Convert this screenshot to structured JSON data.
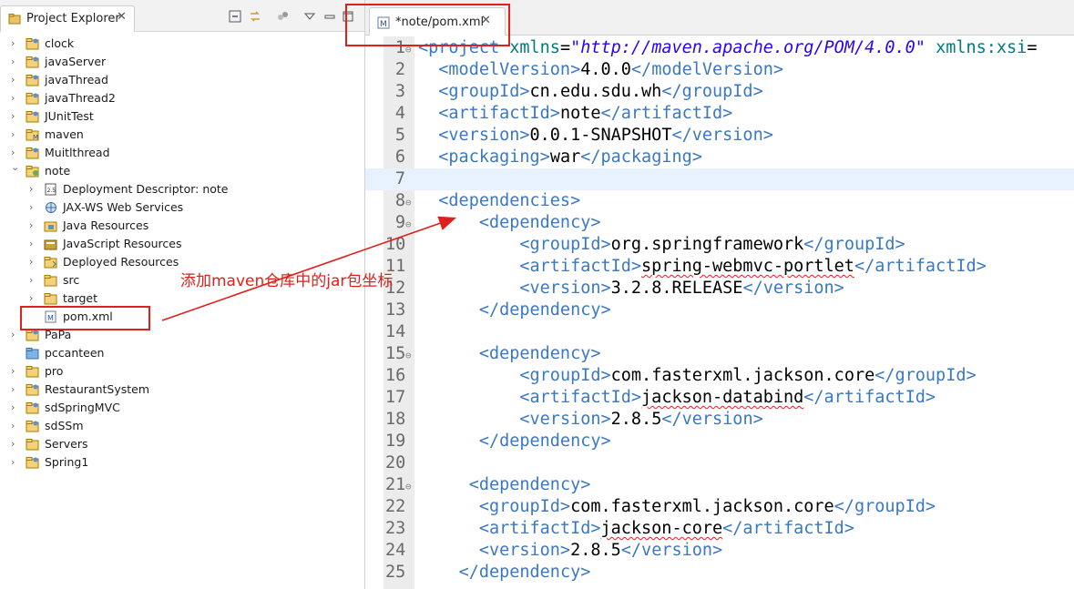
{
  "explorer": {
    "title": "Project Explorer",
    "close_glyph": "✕",
    "toolbar": [
      "collapse-all-icon",
      "link-with-editor-icon",
      "filters-icon",
      "view-menu-icon",
      "minimize-icon",
      "maximize-icon"
    ],
    "items": [
      {
        "label": "clock",
        "depth": 0,
        "expanded": false,
        "icon": "java-project-icon"
      },
      {
        "label": "javaServer",
        "depth": 0,
        "expanded": false,
        "icon": "java-project-icon"
      },
      {
        "label": "javaThread",
        "depth": 0,
        "expanded": false,
        "icon": "java-project-icon"
      },
      {
        "label": "javaThread2",
        "depth": 0,
        "expanded": false,
        "icon": "java-project-icon"
      },
      {
        "label": "JUnitTest",
        "depth": 0,
        "expanded": false,
        "icon": "java-project-icon"
      },
      {
        "label": "maven",
        "depth": 0,
        "expanded": false,
        "icon": "maven-project-icon"
      },
      {
        "label": "Muitlthread",
        "depth": 0,
        "expanded": false,
        "icon": "java-project-icon"
      },
      {
        "label": "note",
        "depth": 0,
        "expanded": true,
        "icon": "web-project-icon"
      },
      {
        "label": "Deployment Descriptor: note",
        "depth": 1,
        "expanded": false,
        "icon": "deployment-descriptor-icon"
      },
      {
        "label": "JAX-WS Web Services",
        "depth": 1,
        "expanded": false,
        "icon": "web-services-icon"
      },
      {
        "label": "Java Resources",
        "depth": 1,
        "expanded": false,
        "icon": "java-resources-icon"
      },
      {
        "label": "JavaScript Resources",
        "depth": 1,
        "expanded": false,
        "icon": "javascript-resources-icon"
      },
      {
        "label": "Deployed Resources",
        "depth": 1,
        "expanded": false,
        "icon": "deployed-resources-icon"
      },
      {
        "label": "src",
        "depth": 1,
        "expanded": false,
        "icon": "folder-icon"
      },
      {
        "label": "target",
        "depth": 1,
        "expanded": false,
        "icon": "folder-icon"
      },
      {
        "label": "pom.xml",
        "depth": 1,
        "leaf": true,
        "icon": "maven-pom-file-icon"
      },
      {
        "label": "PaPa",
        "depth": 0,
        "expanded": false,
        "icon": "java-project-icon"
      },
      {
        "label": "pccanteen",
        "depth": 0,
        "leaf": true,
        "icon": "plain-folder-icon"
      },
      {
        "label": "pro",
        "depth": 0,
        "expanded": false,
        "icon": "folder-icon"
      },
      {
        "label": "RestaurantSystem",
        "depth": 0,
        "expanded": false,
        "icon": "java-project-icon"
      },
      {
        "label": "sdSpringMVC",
        "depth": 0,
        "expanded": false,
        "icon": "java-project-icon"
      },
      {
        "label": "sdSSm",
        "depth": 0,
        "expanded": false,
        "icon": "java-project-icon"
      },
      {
        "label": "Servers",
        "depth": 0,
        "expanded": false,
        "icon": "folder-icon"
      },
      {
        "label": "Spring1",
        "depth": 0,
        "expanded": false,
        "icon": "java-project-icon"
      }
    ]
  },
  "editor": {
    "tab_title": "*note/pom.xml",
    "close_glyph": "✕",
    "current_line": 7,
    "lines": [
      {
        "n": "1",
        "fold": true,
        "tokens": [
          [
            "t",
            "<project "
          ],
          [
            "a",
            "xmlns"
          ],
          [
            "p",
            "="
          ],
          [
            "v",
            "\"http://maven.apache.org/POM/4.0.0\""
          ],
          [
            "p",
            " "
          ],
          [
            "a",
            "xmlns:xsi"
          ],
          [
            "p",
            "="
          ]
        ]
      },
      {
        "n": "2",
        "tokens": [
          [
            "p",
            "  "
          ],
          [
            "t",
            "<modelVersion>"
          ],
          [
            "p",
            "4.0.0"
          ],
          [
            "t",
            "</modelVersion>"
          ]
        ]
      },
      {
        "n": "3",
        "tokens": [
          [
            "p",
            "  "
          ],
          [
            "t",
            "<groupId>"
          ],
          [
            "p",
            "cn.edu.sdu.wh"
          ],
          [
            "t",
            "</groupId>"
          ]
        ]
      },
      {
        "n": "4",
        "tokens": [
          [
            "p",
            "  "
          ],
          [
            "t",
            "<artifactId>"
          ],
          [
            "p",
            "note"
          ],
          [
            "t",
            "</artifactId>"
          ]
        ]
      },
      {
        "n": "5",
        "tokens": [
          [
            "p",
            "  "
          ],
          [
            "t",
            "<version>"
          ],
          [
            "p",
            "0.0.1-SNAPSHOT"
          ],
          [
            "t",
            "</version>"
          ]
        ]
      },
      {
        "n": "6",
        "tokens": [
          [
            "p",
            "  "
          ],
          [
            "t",
            "<packaging>"
          ],
          [
            "p",
            "war"
          ],
          [
            "t",
            "</packaging>"
          ]
        ]
      },
      {
        "n": "7",
        "tokens": []
      },
      {
        "n": "8",
        "fold": true,
        "tokens": [
          [
            "p",
            "  "
          ],
          [
            "t",
            "<dependencies>"
          ]
        ]
      },
      {
        "n": "9",
        "fold": true,
        "tokens": [
          [
            "p",
            "      "
          ],
          [
            "t",
            "<dependency>"
          ]
        ]
      },
      {
        "n": "10",
        "tokens": [
          [
            "p",
            "          "
          ],
          [
            "t",
            "<groupId>"
          ],
          [
            "p",
            "org.springframework"
          ],
          [
            "t",
            "</groupId>"
          ]
        ]
      },
      {
        "n": "11",
        "tokens": [
          [
            "p",
            "          "
          ],
          [
            "t",
            "<artifactId>"
          ],
          [
            "s",
            "spring-webmvc-portlet"
          ],
          [
            "t",
            "</artifactId>"
          ]
        ]
      },
      {
        "n": "12",
        "tokens": [
          [
            "p",
            "          "
          ],
          [
            "t",
            "<version>"
          ],
          [
            "p",
            "3.2.8.RELEASE"
          ],
          [
            "t",
            "</version>"
          ]
        ]
      },
      {
        "n": "13",
        "tokens": [
          [
            "p",
            "      "
          ],
          [
            "t",
            "</dependency>"
          ]
        ]
      },
      {
        "n": "14",
        "tokens": []
      },
      {
        "n": "15",
        "fold": true,
        "tokens": [
          [
            "p",
            "      "
          ],
          [
            "t",
            "<dependency>"
          ]
        ]
      },
      {
        "n": "16",
        "tokens": [
          [
            "p",
            "          "
          ],
          [
            "t",
            "<groupId>"
          ],
          [
            "p",
            "com.fasterxml.jackson.core"
          ],
          [
            "t",
            "</groupId>"
          ]
        ]
      },
      {
        "n": "17",
        "tokens": [
          [
            "p",
            "          "
          ],
          [
            "t",
            "<artifactId>"
          ],
          [
            "s",
            "jackson-databind"
          ],
          [
            "t",
            "</artifactId>"
          ]
        ]
      },
      {
        "n": "18",
        "tokens": [
          [
            "p",
            "          "
          ],
          [
            "t",
            "<version>"
          ],
          [
            "p",
            "2.8.5"
          ],
          [
            "t",
            "</version>"
          ]
        ]
      },
      {
        "n": "19",
        "tokens": [
          [
            "p",
            "      "
          ],
          [
            "t",
            "</dependency>"
          ]
        ]
      },
      {
        "n": "20",
        "tokens": []
      },
      {
        "n": "21",
        "fold": true,
        "tokens": [
          [
            "p",
            "     "
          ],
          [
            "t",
            "<dependency>"
          ]
        ]
      },
      {
        "n": "22",
        "tokens": [
          [
            "p",
            "      "
          ],
          [
            "t",
            "<groupId>"
          ],
          [
            "p",
            "com.fasterxml.jackson.core"
          ],
          [
            "t",
            "</groupId>"
          ]
        ]
      },
      {
        "n": "23",
        "tokens": [
          [
            "p",
            "      "
          ],
          [
            "t",
            "<artifactId>"
          ],
          [
            "s",
            "jackson-core"
          ],
          [
            "t",
            "</artifactId>"
          ]
        ]
      },
      {
        "n": "24",
        "tokens": [
          [
            "p",
            "      "
          ],
          [
            "t",
            "<version>"
          ],
          [
            "p",
            "2.8.5"
          ],
          [
            "t",
            "</version>"
          ]
        ]
      },
      {
        "n": "25",
        "tokens": [
          [
            "p",
            "    "
          ],
          [
            "t",
            "</dependency>"
          ]
        ]
      }
    ]
  },
  "annotation": {
    "text": "添加maven仓库中的jar包坐标",
    "color": "#e0201a"
  },
  "colors": {
    "tag": "#3c78c2",
    "attribute": "#007c7c",
    "attribute_value": "#2a00ff",
    "current_line": "#e8f2fe"
  }
}
